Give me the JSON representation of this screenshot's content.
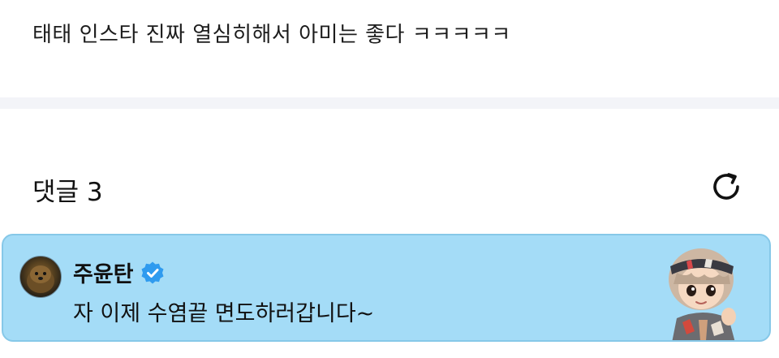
{
  "post": {
    "body_text": "태태 인스타 진짜 열심히해서 아미는 좋다 ㅋㅋㅋㅋㅋ"
  },
  "comments": {
    "title": "댓글 3",
    "refresh_icon": "refresh-icon"
  },
  "comment": {
    "author": "주윤탄",
    "verified_icon": "verified-badge-icon",
    "text": "자 이제 수염끝 면도하러갑니다~",
    "avatar": "avatar",
    "sticker": "character-sticker"
  },
  "colors": {
    "divider": "#f3f4f8",
    "card_background": "#a4dcf7",
    "card_border": "#86c8e8",
    "verified": "#2f9bef"
  }
}
